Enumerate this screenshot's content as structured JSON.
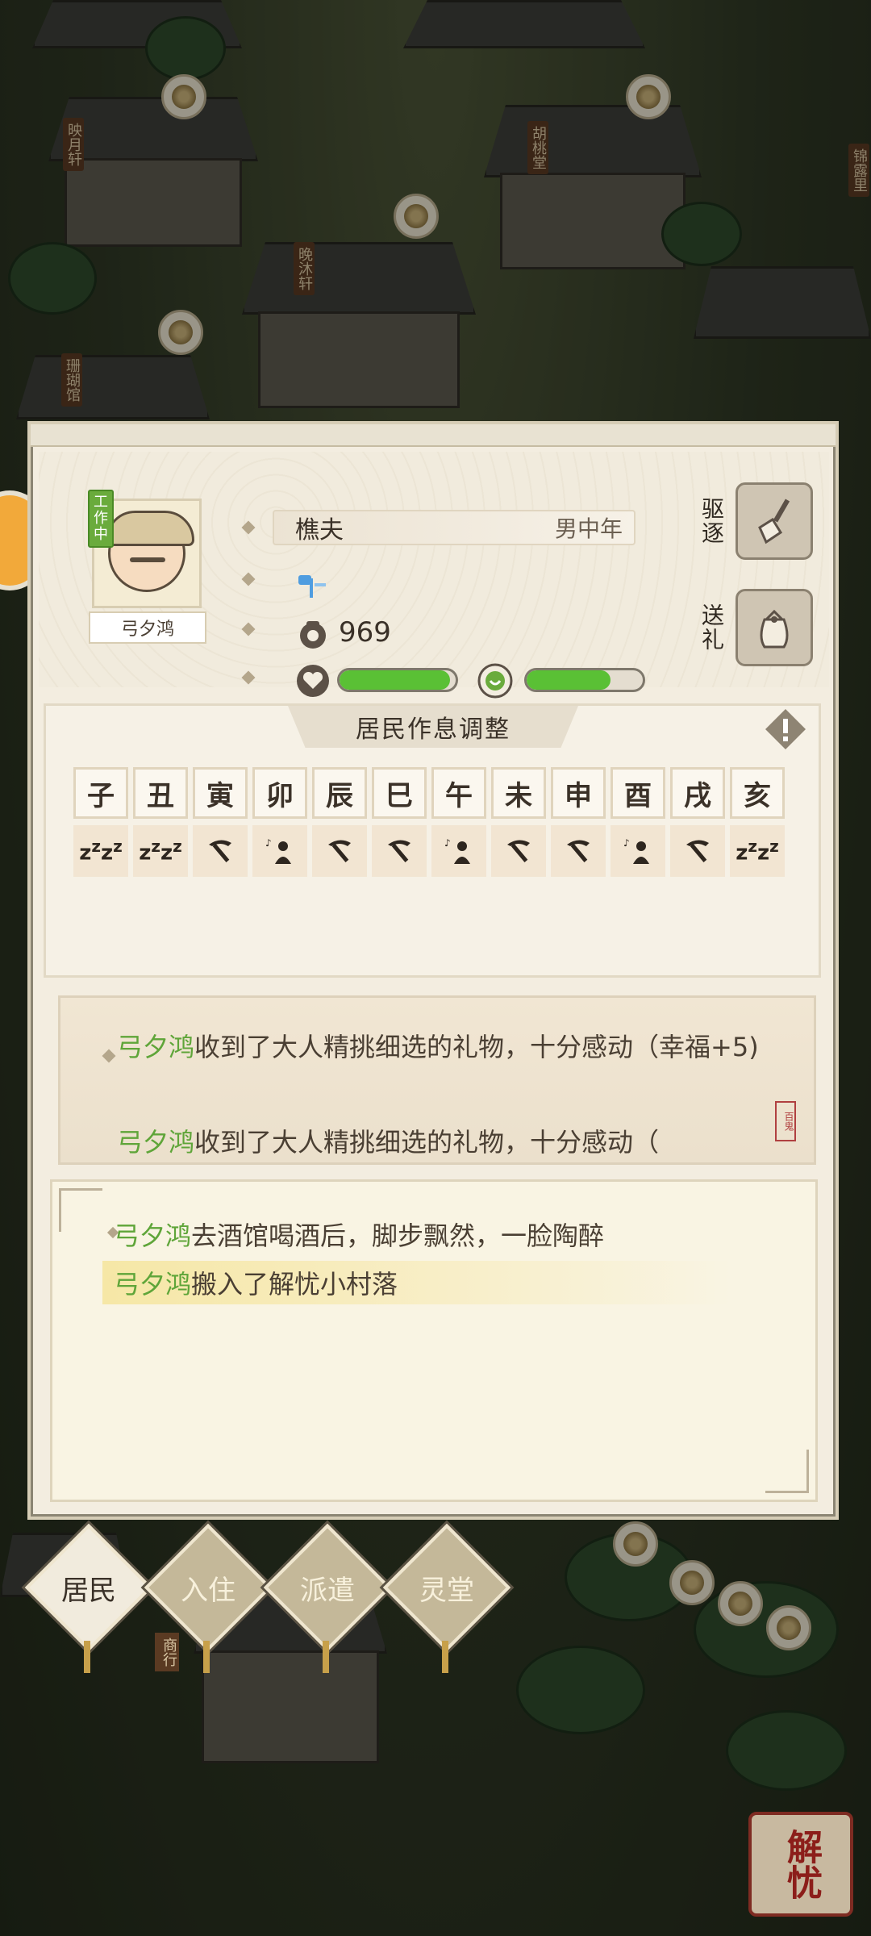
{
  "scene": {
    "building_signs": [
      "映月轩",
      "胡桃堂",
      "晚沐轩",
      "珊瑚馆",
      "锦露里"
    ],
    "shop_sign": "商行"
  },
  "resident": {
    "status_badge": "工作中",
    "name": "弓夕鸿",
    "job": "樵夫",
    "gender_age": "男中年",
    "money": "969",
    "health_level": 0.95,
    "happiness_level": 0.72
  },
  "actions": {
    "expel_label": "驱逐",
    "gift_label": "送礼"
  },
  "schedule": {
    "title": "居民作息调整",
    "hours": [
      "子",
      "丑",
      "寅",
      "卯",
      "辰",
      "巳",
      "午",
      "未",
      "申",
      "酉",
      "戌",
      "亥"
    ],
    "activities": [
      "sleep",
      "sleep",
      "work",
      "leisure",
      "work",
      "work",
      "leisure",
      "work",
      "work",
      "leisure",
      "work",
      "sleep"
    ]
  },
  "gift_log": {
    "items": [
      {
        "name": "弓夕鸿",
        "text": "收到了大人精挑细选的礼物，十分感动（幸福+5)"
      },
      {
        "name": "弓夕鸿",
        "text": "收到了大人精挑细选的礼物，十分感动（"
      }
    ],
    "seal": "百鬼"
  },
  "event_log": {
    "items": [
      {
        "name": "弓夕鸿",
        "text": "去酒馆喝酒后，脚步飘然，一脸陶醉"
      },
      {
        "name": "弓夕鸿",
        "text": "搬入了解忧小村落"
      }
    ]
  },
  "tabs": [
    {
      "label": "居民",
      "active": true
    },
    {
      "label": "入住",
      "active": false
    },
    {
      "label": "派遣",
      "active": false
    },
    {
      "label": "灵堂",
      "active": false
    }
  ],
  "corner_logo": "解忧",
  "colors": {
    "name_green": "#5fa539",
    "bar_green": "#5ac035",
    "panel_bg": "#f3ede0"
  }
}
